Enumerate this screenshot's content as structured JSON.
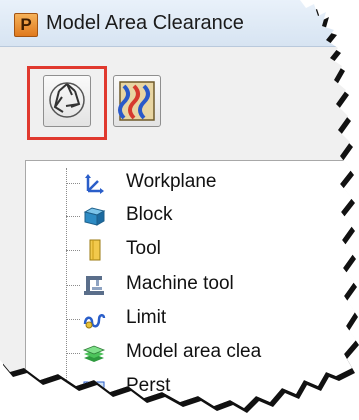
{
  "window": {
    "app_icon_letter": "P",
    "title": "Model Area Clearance"
  },
  "toolbar": {
    "buttons": [
      {
        "icon": "recycle-icon"
      },
      {
        "icon": "pattern-tiles-icon"
      }
    ]
  },
  "tree": {
    "items": [
      {
        "label": "Workplane",
        "icon": "workplane-axes-icon"
      },
      {
        "label": "Block",
        "icon": "block-cube-icon"
      },
      {
        "label": "Tool",
        "icon": "tool-icon"
      },
      {
        "label": "Machine tool",
        "icon": "machine-tool-icon"
      },
      {
        "label": "Limit",
        "icon": "limit-icon"
      },
      {
        "label": "Model area clea",
        "icon": "model-area-clearance-icon"
      },
      {
        "label": "Perst",
        "icon": "parameter-icon"
      }
    ]
  },
  "colors": {
    "highlight": "#e0392e",
    "titlebar": "#dfe9f5"
  }
}
